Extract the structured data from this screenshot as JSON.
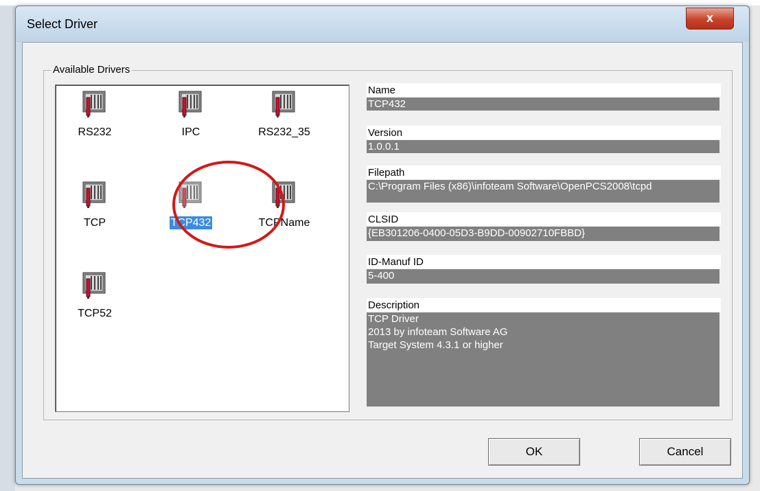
{
  "window": {
    "title": "Select Driver",
    "close_glyph": "x"
  },
  "group": {
    "label": "Available Drivers"
  },
  "drivers": [
    {
      "label": "RS232",
      "icon": "driver-rack-icon"
    },
    {
      "label": "IPC",
      "icon": "driver-rack-icon"
    },
    {
      "label": "RS232_35",
      "icon": "driver-rack-icon"
    },
    {
      "label": "TCP",
      "icon": "driver-rack-icon"
    },
    {
      "label": "TCP432",
      "icon": "driver-rack-icon",
      "selected": true
    },
    {
      "label": "TCPName",
      "icon": "driver-rack-icon"
    },
    {
      "label": "TCP52",
      "icon": "driver-rack-icon"
    }
  ],
  "details": {
    "name_label": "Name",
    "name_value": "TCP432",
    "version_label": "Version",
    "version_value": "1.0.0.1",
    "filepath_label": "Filepath",
    "filepath_value": "C:\\Program Files (x86)\\infoteam Software\\OpenPCS2008\\tcpd",
    "clsid_label": "CLSID",
    "clsid_value": "{EB301206-0400-05D3-B9DD-00902710FBBD}",
    "manuf_label": "ID-Manuf ID",
    "manuf_value": "5-400",
    "description_label": "Description",
    "description_value": "TCP Driver\n2013 by infoteam Software AG\n Target System 4.3.1 or higher"
  },
  "buttons": {
    "ok": "OK",
    "cancel": "Cancel"
  },
  "colors": {
    "selection": "#3b8be0",
    "annotation_circle": "#d41818",
    "value_field": "#808080"
  }
}
